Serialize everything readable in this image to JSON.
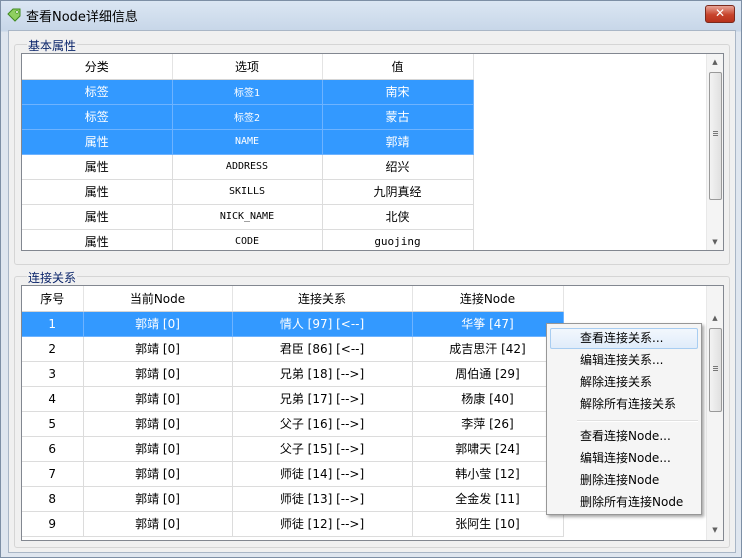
{
  "window": {
    "title": "查看Node详细信息",
    "close_label": "✕"
  },
  "basic": {
    "group_label": "基本属性",
    "columns": [
      "分类",
      "选项",
      "值"
    ],
    "rows": [
      {
        "cat": "标签",
        "opt": "标签1",
        "val": "南宋",
        "selected": true
      },
      {
        "cat": "标签",
        "opt": "标签2",
        "val": "蒙古",
        "selected": true
      },
      {
        "cat": "属性",
        "opt": "NAME",
        "val": "郭靖",
        "selected": true
      },
      {
        "cat": "属性",
        "opt": "ADDRESS",
        "val": "绍兴",
        "selected": false
      },
      {
        "cat": "属性",
        "opt": "SKILLS",
        "val": "九阴真经",
        "selected": false
      },
      {
        "cat": "属性",
        "opt": "NICK_NAME",
        "val": "北侠",
        "selected": false
      },
      {
        "cat": "属性",
        "opt": "CODE",
        "val": "guojing",
        "selected": false
      }
    ]
  },
  "relations": {
    "group_label": "连接关系",
    "columns": [
      "序号",
      "当前Node",
      "连接关系",
      "连接Node"
    ],
    "rows": [
      {
        "no": "1",
        "cur": "郭靖 [0]",
        "rel": "情人 [97] [<--]",
        "target": "华筝 [47]",
        "selected": true
      },
      {
        "no": "2",
        "cur": "郭靖 [0]",
        "rel": "君臣 [86] [<--]",
        "target": "成吉思汗 [42]",
        "selected": false
      },
      {
        "no": "3",
        "cur": "郭靖 [0]",
        "rel": "兄弟 [18] [-->]",
        "target": "周伯通 [29]",
        "selected": false
      },
      {
        "no": "4",
        "cur": "郭靖 [0]",
        "rel": "兄弟 [17] [-->]",
        "target": "杨康 [40]",
        "selected": false
      },
      {
        "no": "5",
        "cur": "郭靖 [0]",
        "rel": "父子 [16] [-->]",
        "target": "李萍 [26]",
        "selected": false
      },
      {
        "no": "6",
        "cur": "郭靖 [0]",
        "rel": "父子 [15] [-->]",
        "target": "郭啸天 [24]",
        "selected": false
      },
      {
        "no": "7",
        "cur": "郭靖 [0]",
        "rel": "师徒 [14] [-->]",
        "target": "韩小莹 [12]",
        "selected": false
      },
      {
        "no": "8",
        "cur": "郭靖 [0]",
        "rel": "师徒 [13] [-->]",
        "target": "全金发 [11]",
        "selected": false
      },
      {
        "no": "9",
        "cur": "郭靖 [0]",
        "rel": "师徒 [12] [-->]",
        "target": "张阿生 [10]",
        "selected": false
      }
    ]
  },
  "context_menu": {
    "items": [
      "查看连接关系...",
      "编辑连接关系...",
      "解除连接关系",
      "解除所有连接关系",
      "查看连接Node...",
      "编辑连接Node...",
      "删除连接Node",
      "删除所有连接Node"
    ],
    "highlighted": "查看连接关系..."
  },
  "colors": {
    "selection": "#3399ff",
    "group_label": "#0a246a",
    "close_button": "#c7432c"
  }
}
